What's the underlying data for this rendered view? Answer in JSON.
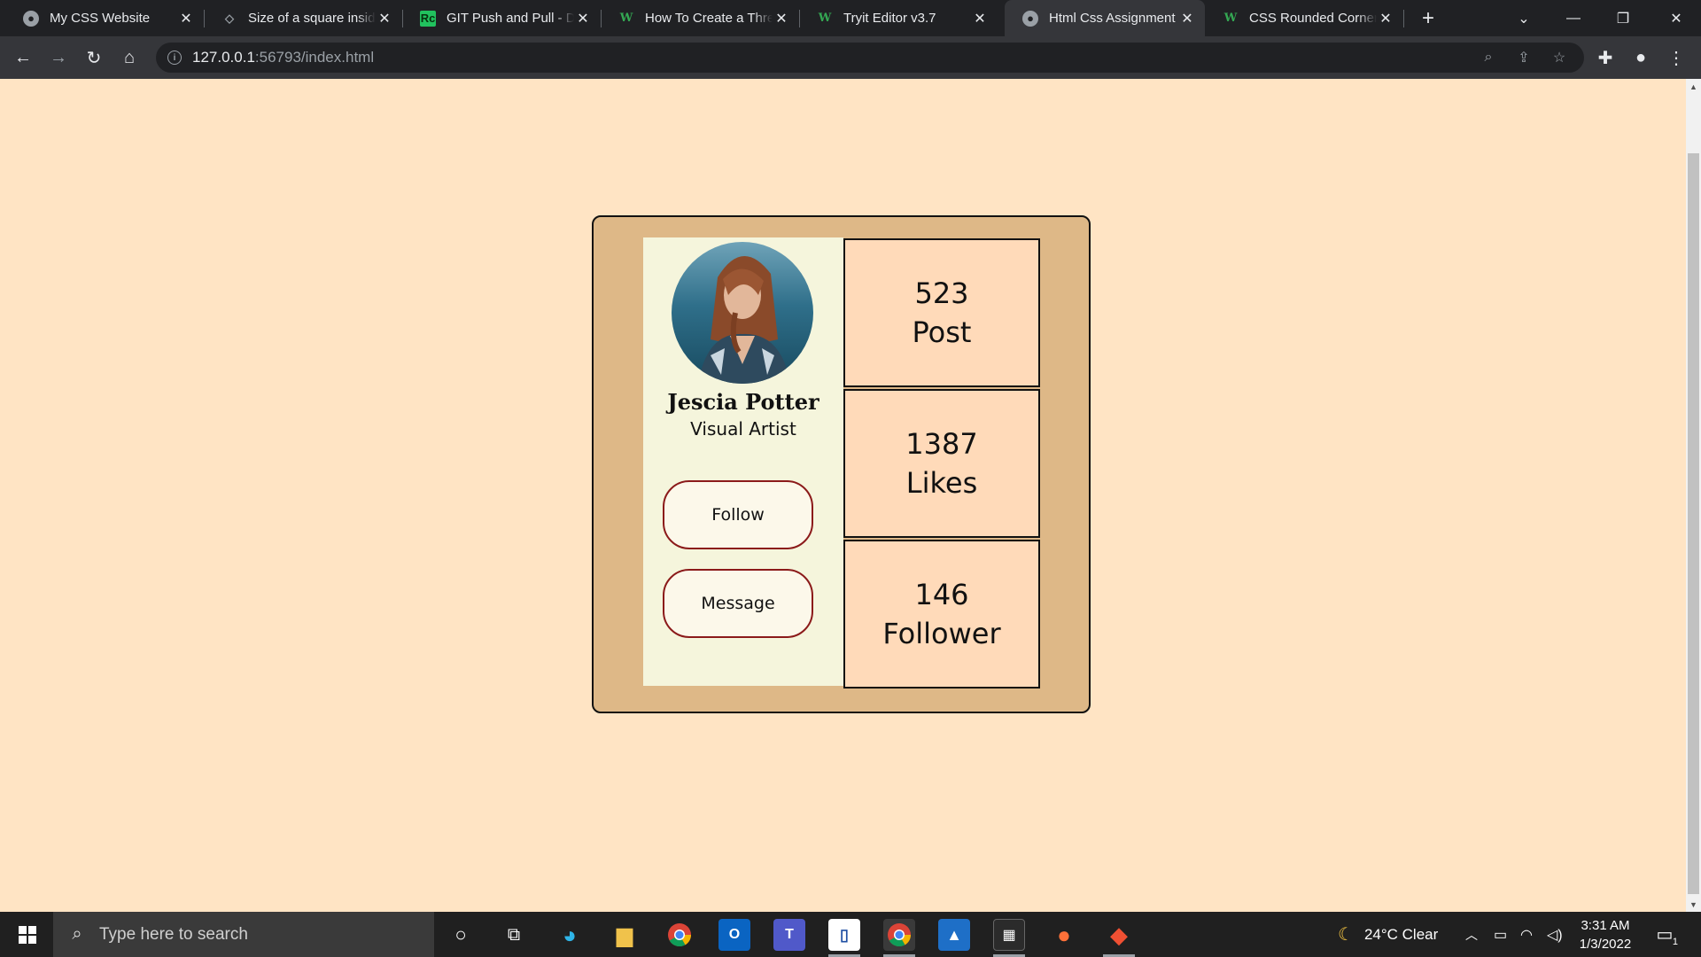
{
  "browser": {
    "tabs": [
      {
        "title": "My CSS Website",
        "favicon": "globe-icon"
      },
      {
        "title": "Size of a square inside",
        "favicon": "square-icon"
      },
      {
        "title": "GIT Push and Pull - Da",
        "favicon": "rc-icon"
      },
      {
        "title": "How To Create a Three",
        "favicon": "w3-icon"
      },
      {
        "title": "Tryit Editor v3.7",
        "favicon": "w3-icon"
      },
      {
        "title": "Html Css Assignment",
        "favicon": "globe-icon",
        "active": true
      },
      {
        "title": "CSS Rounded Corners",
        "favicon": "w3-icon"
      }
    ],
    "url_host": "127.0.0.1",
    "url_rest": ":56793/index.html"
  },
  "page": {
    "background": "#ffe4c4",
    "card": {
      "name": "Jescia Potter",
      "role": "Visual Artist",
      "follow_label": "Follow",
      "message_label": "Message",
      "stats": [
        {
          "value": "523",
          "label": "Post"
        },
        {
          "value": "1387",
          "label": "Likes"
        },
        {
          "value": "146",
          "label": "Follower"
        }
      ]
    }
  },
  "taskbar": {
    "search_placeholder": "Type here to search",
    "weather": "24°C  Clear",
    "time": "3:31 AM",
    "date": "1/3/2022",
    "notification_count": "1"
  },
  "colors": {
    "card_bg": "#deb887",
    "panel_bg": "#f5f5dc",
    "stat_bg": "#ffdab9",
    "button_border": "#8b1a1a"
  }
}
